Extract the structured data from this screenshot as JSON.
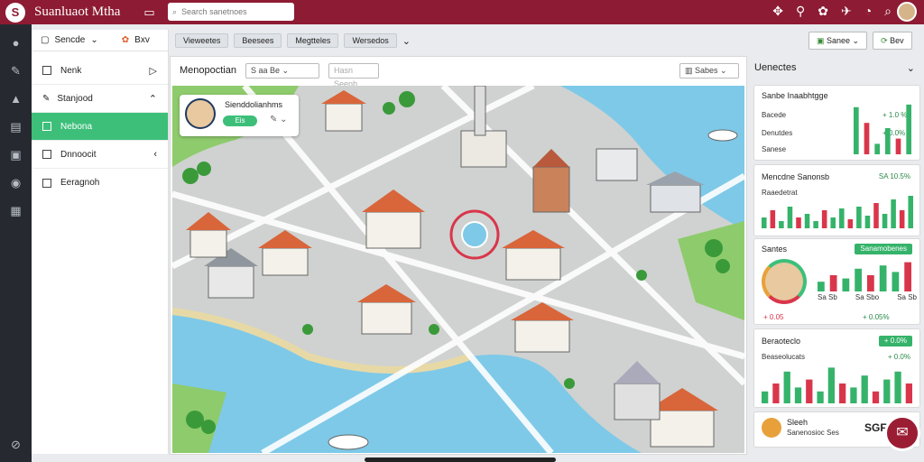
{
  "app": {
    "title": "Suanluaot Mtha",
    "logo_letter": "S"
  },
  "search": {
    "placeholder": "Search sanetnoes"
  },
  "sidebar": {
    "header_label": "Sencde",
    "header_right": "Bxv",
    "items": [
      {
        "label": "Nenk",
        "active": false
      },
      {
        "label": "Stanjood",
        "active": false
      },
      {
        "label": "Nebona",
        "active": true
      },
      {
        "label": "Dnnoocit",
        "active": false
      },
      {
        "label": "Eeragnoh",
        "active": false
      }
    ]
  },
  "filters": [
    "Vieweetes",
    "Beesees",
    "Megtteles",
    "Wersedos"
  ],
  "top_right": {
    "button1": "Sanee",
    "button2": "Bev"
  },
  "main": {
    "title": "Menopoctian",
    "select1": "S aa Be",
    "select2": "Hasn Seenb",
    "select3": "Sabes"
  },
  "map": {
    "profile_title": "Sienddolianhms",
    "profile_toggle_label": "Eis"
  },
  "right": {
    "title": "Uenectes",
    "card1": {
      "title": "Sanbe Inaabhtgge",
      "rows": [
        "Bacede",
        "Denutdes",
        "Sanese"
      ],
      "values": [
        "+ 1.0 %",
        "+ 0.0%"
      ],
      "bars": [
        0.9,
        0.6,
        0.2,
        0.5,
        0.3,
        0.95
      ]
    },
    "card2": {
      "title": "Mencdne Sanonsb",
      "value": "SA 10.5%",
      "sub": "Raaedetrat",
      "bars": [
        0.3,
        0.5,
        0.2,
        0.6,
        0.3,
        0.4,
        0.2,
        0.5,
        0.3,
        0.55,
        0.25,
        0.6,
        0.35,
        0.7,
        0.4,
        0.8,
        0.5,
        0.9
      ]
    },
    "card3": {
      "title": "Santes",
      "tag": "Sanamobenes",
      "values": [
        "+ 0.05",
        "+ 0.05%"
      ],
      "bottom": [
        "Sa Sb",
        "Sa Sbo",
        "Sa Sb"
      ],
      "bars": [
        0.3,
        0.5,
        0.4,
        0.7,
        0.5,
        0.8,
        0.6,
        0.9
      ]
    },
    "card4": {
      "title": "Beraoteclo",
      "tag": "+ 0.0%",
      "sub": "Beaseolucats",
      "sub_val": "+ 0.0%",
      "bars": [
        0.3,
        0.5,
        0.8,
        0.4,
        0.6,
        0.3,
        0.9,
        0.5,
        0.4,
        0.7,
        0.3,
        0.6,
        0.8,
        0.5
      ]
    },
    "card5": {
      "title": "Sleeh",
      "sub": "Sanenosioc Ses",
      "value": "SGF"
    }
  },
  "colors": {
    "brand": "#8d1b33",
    "accent": "#3dbf7a",
    "bar_green": "#35b36a",
    "bar_red": "#d9364b"
  }
}
